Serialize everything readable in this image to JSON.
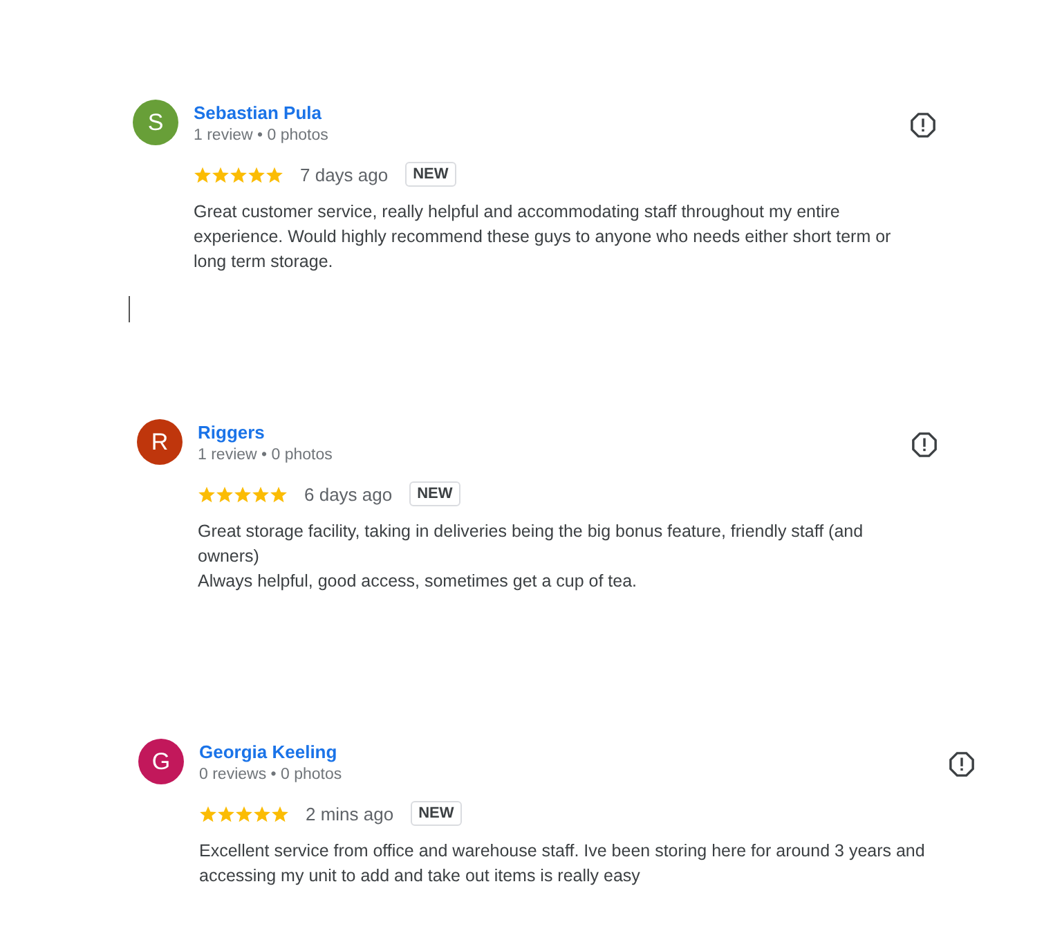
{
  "reviews": [
    {
      "initial": "S",
      "color": "#689f38",
      "name": "Sebastian Pula",
      "meta": "1 review • 0 photos",
      "stars": 5,
      "time": "7 days ago",
      "badge": "NEW",
      "text": "Great customer service, really helpful and accommodating staff throughout my entire experience. Would highly recommend these guys to anyone who needs either short term or long term storage."
    },
    {
      "initial": "R",
      "color": "#bf360c",
      "name": "Riggers",
      "meta": "1 review • 0 photos",
      "stars": 5,
      "time": "6 days ago",
      "badge": "NEW",
      "text": "Great storage facility, taking in deliveries being the big bonus feature, friendly staff (and owners)\nAlways helpful, good access, sometimes get a cup of tea."
    },
    {
      "initial": "G",
      "color": "#c2185b",
      "name": "Georgia Keeling",
      "meta": "0 reviews • 0 photos",
      "stars": 5,
      "time": "2 mins ago",
      "badge": "NEW",
      "text": "Excellent service from office and warehouse staff. Ive been storing here for around 3 years and accessing my unit to add and take out items is really easy"
    }
  ]
}
